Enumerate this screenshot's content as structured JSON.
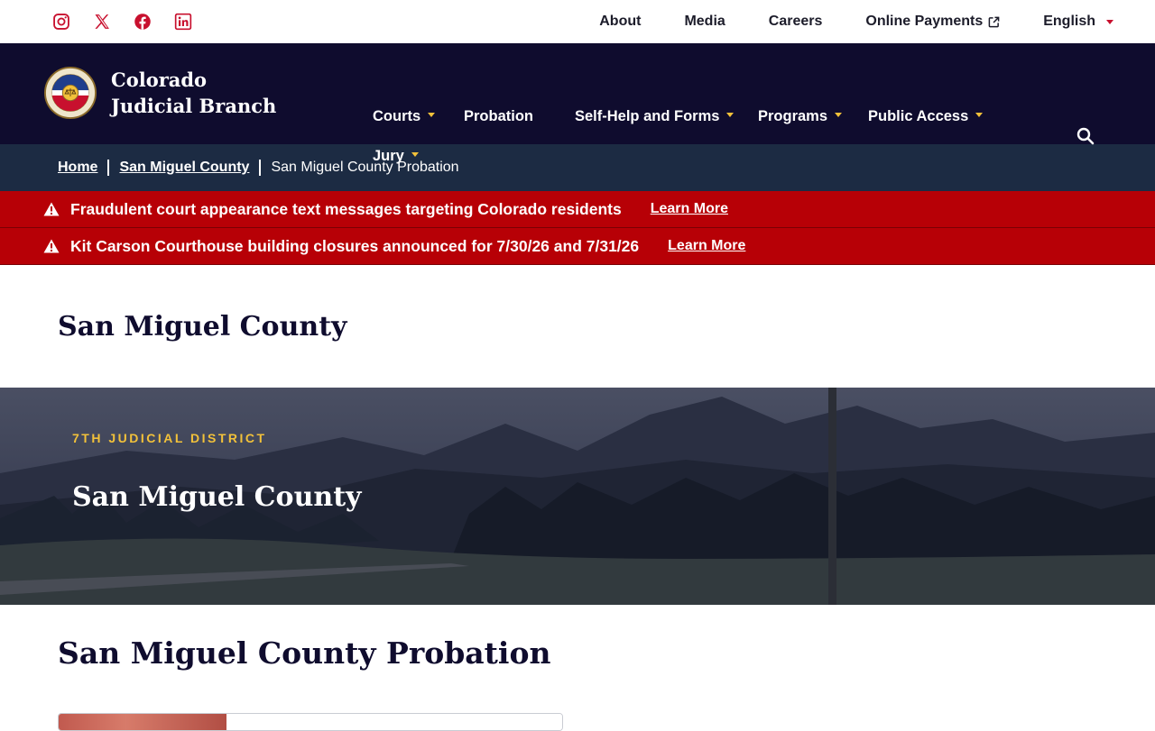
{
  "colors": {
    "navy": "#0f0c2e",
    "breadcrumb_bg": "#1c2b43",
    "alert_red": "#b70006",
    "gold": "#f2c13a",
    "social_red": "#c8102e"
  },
  "social": [
    {
      "icon": "instagram-icon"
    },
    {
      "icon": "x-icon"
    },
    {
      "icon": "facebook-icon"
    },
    {
      "icon": "linkedin-icon"
    }
  ],
  "utility_nav": {
    "about": "About",
    "media": "Media",
    "careers": "Careers",
    "online_payments": "Online Payments",
    "language": "English"
  },
  "brand": {
    "name": "Colorado Judicial Branch",
    "seal_top": "COLORADO",
    "seal_bottom": "COURTS"
  },
  "main_nav": {
    "courts": "Courts",
    "probation": "Probation",
    "self_help": "Self-Help and Forms",
    "programs": "Programs",
    "public_access": "Public Access",
    "jury": "Jury"
  },
  "breadcrumb": {
    "home": "Home",
    "county": "San Miguel County",
    "current": "San Miguel County Probation"
  },
  "alerts": [
    {
      "text": "Fraudulent court appearance text messages targeting Colorado residents",
      "link": "Learn More"
    },
    {
      "text": "Kit Carson Courthouse building closures announced for 7/30/26 and 7/31/26",
      "link": "Learn More"
    }
  ],
  "page": {
    "title": "San Miguel County"
  },
  "hero": {
    "eyebrow": "7TH JUDICIAL DISTRICT",
    "title": "San Miguel County"
  },
  "section": {
    "title": "San Miguel County Probation"
  }
}
